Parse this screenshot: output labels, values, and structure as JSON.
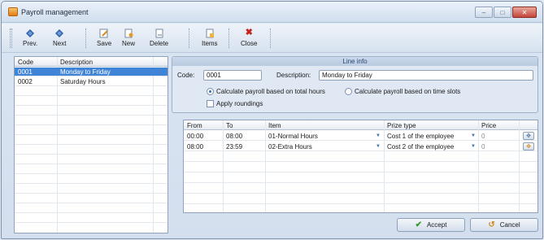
{
  "window": {
    "title": "Payroll management",
    "min": "–",
    "max": "□",
    "close": "✕"
  },
  "toolbar": {
    "prev": "Prev.",
    "next": "Next",
    "save": "Save",
    "new": "New",
    "delete": "Delete",
    "items": "Items",
    "close": "Close"
  },
  "list": {
    "col_code": "Code",
    "col_description": "Description",
    "rows": [
      {
        "code": "0001",
        "description": "Monday to Friday",
        "selected": true
      },
      {
        "code": "0002",
        "description": "Saturday Hours",
        "selected": false
      }
    ]
  },
  "lineinfo": {
    "title": "Line info",
    "code_label": "Code:",
    "code_value": "0001",
    "desc_label": "Description:",
    "desc_value": "Monday to Friday",
    "radio_total": "Calculate payroll based on total hours",
    "radio_slots": "Calculate payroll based on time slots",
    "apply_roundings": "Apply roundings"
  },
  "grid": {
    "headers": {
      "from": "From",
      "to": "To",
      "item": "Item",
      "prize_type": "Prize type",
      "price": "Price"
    },
    "rows": [
      {
        "from": "00:00",
        "to": "08:00",
        "item": "01-Normal Hours",
        "prize_type": "Cost 1 of the employee",
        "price": "0"
      },
      {
        "from": "08:00",
        "to": "23:59",
        "item": "02-Extra Hours",
        "prize_type": "Cost 2 of the employee",
        "price": "0"
      }
    ]
  },
  "buttons": {
    "accept": "Accept",
    "cancel": "Cancel"
  },
  "colors": {
    "selection": "#3f84d6",
    "delete_icon": "#c8231b",
    "nav_icon": "#2f5fa8",
    "accept_icon": "#3a9a2c"
  }
}
